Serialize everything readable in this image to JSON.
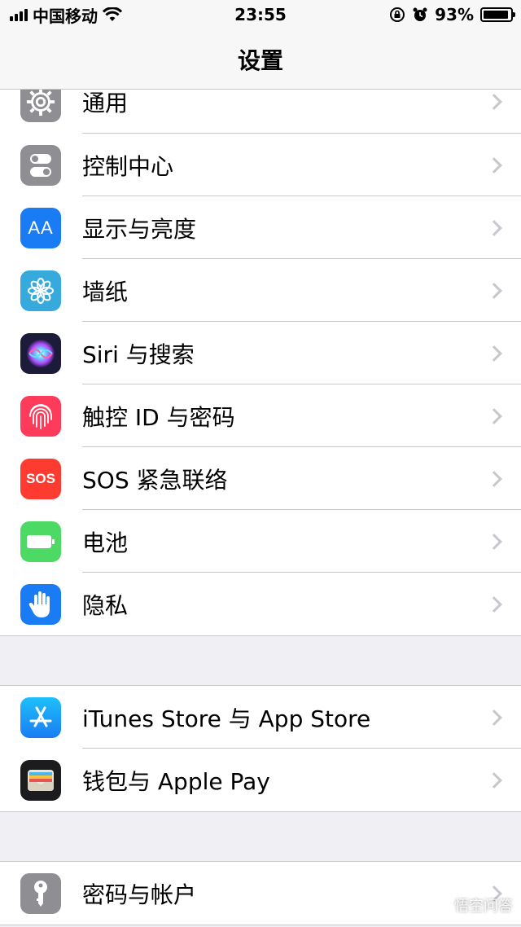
{
  "status_bar": {
    "carrier": "中国移动",
    "time": "23:55",
    "battery_percent": "93%",
    "battery_level": 0.93
  },
  "nav": {
    "title": "设置"
  },
  "groups": [
    {
      "items": [
        {
          "label": "通用",
          "icon": "gear-icon",
          "color": "#8e8e93"
        },
        {
          "label": "控制中心",
          "icon": "toggles-icon",
          "color": "#8e8e93"
        },
        {
          "label": "显示与亮度",
          "icon": "text-size-icon",
          "icon_text": "AA",
          "color": "#1a7cf5"
        },
        {
          "label": "墙纸",
          "icon": "flower-icon",
          "color": "#36aadc"
        },
        {
          "label": "Siri 与搜索",
          "icon": "siri-icon",
          "color": "#1c1c3a"
        },
        {
          "label": "触控 ID 与密码",
          "icon": "fingerprint-icon",
          "color": "#fe3b5a"
        },
        {
          "label": "SOS 紧急联络",
          "icon": "sos-icon",
          "icon_text": "SOS",
          "color": "#fe3b30"
        },
        {
          "label": "电池",
          "icon": "battery-icon",
          "color": "#4cd964"
        },
        {
          "label": "隐私",
          "icon": "hand-icon",
          "color": "#1a7cf5"
        }
      ]
    },
    {
      "items": [
        {
          "label": "iTunes Store 与 App Store",
          "icon": "app-store-icon",
          "color": "#1a8cf5"
        },
        {
          "label": "钱包与 Apple Pay",
          "icon": "wallet-icon",
          "color": "#1c1c1e"
        }
      ]
    },
    {
      "items": [
        {
          "label": "密码与帐户",
          "icon": "key-icon",
          "color": "#8e8e93"
        }
      ]
    }
  ],
  "watermark": {
    "text": "悟空问答"
  }
}
